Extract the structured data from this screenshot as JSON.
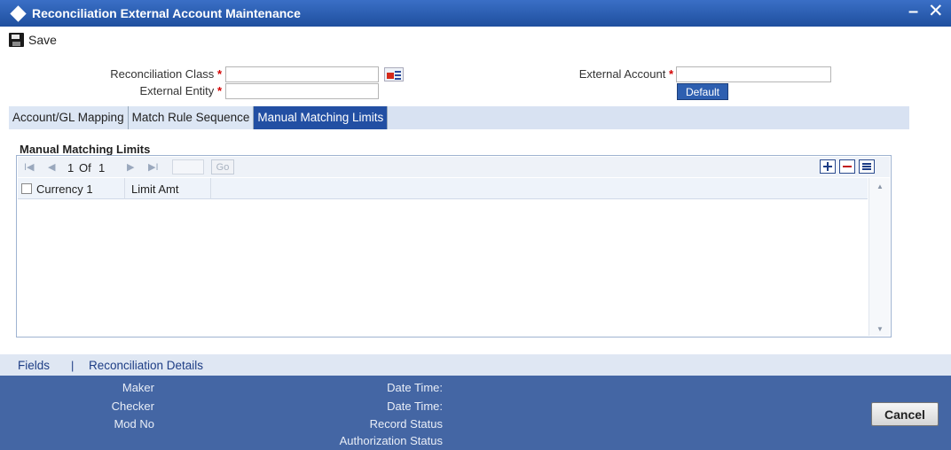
{
  "window": {
    "title": "Reconciliation External Account Maintenance",
    "minimize_glyph": "–",
    "close_glyph": "✕"
  },
  "toolbar": {
    "save_label": "Save"
  },
  "form": {
    "recon_class_label": "Reconciliation Class",
    "recon_class_value": "",
    "external_entity_label": "External Entity",
    "external_entity_value": "",
    "external_account_label": "External Account",
    "external_account_value": "",
    "required_marker": "*",
    "default_button": "Default"
  },
  "tabs": [
    {
      "label": "Account/GL Mapping",
      "active": false
    },
    {
      "label": "Match Rule Sequence",
      "active": false
    },
    {
      "label": "Manual Matching Limits",
      "active": true
    }
  ],
  "grid": {
    "section_title": "Manual Matching Limits",
    "pager": {
      "first": "I◀",
      "prev": "◀",
      "current": "1",
      "of_label": "Of",
      "total": "1",
      "next": "▶",
      "last": "▶I",
      "go_label": "Go"
    },
    "columns": [
      "Currency 1",
      "Limit Amt"
    ],
    "rows": []
  },
  "links": {
    "fields": "Fields",
    "separator": "|",
    "recon_details": "Reconciliation Details"
  },
  "audit": {
    "maker_label": "Maker",
    "checker_label": "Checker",
    "mod_no_label": "Mod No",
    "date_time_label": "Date Time:",
    "record_status_label": "Record Status",
    "auth_status_label": "Authorization Status"
  },
  "cancel_button": "Cancel",
  "colors": {
    "title_bar": "#1f4f9e",
    "active_tab": "#224fa3",
    "footer": "#4466a4",
    "required": "#d40000"
  }
}
